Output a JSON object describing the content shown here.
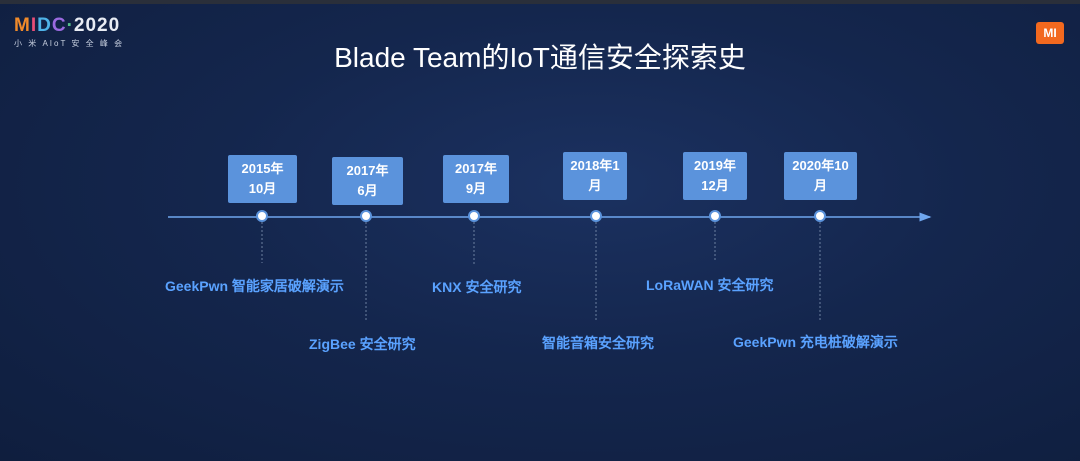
{
  "header": {
    "logo_text_parts": [
      "M",
      "I",
      "D",
      "C",
      "·"
    ],
    "logo_year": "2020",
    "logo_subtitle": "小 米 AIoT 安 全 峰 会",
    "brand_badge": "MI"
  },
  "slide": {
    "title": "Blade Team的IoT通信安全探索史"
  },
  "timeline": {
    "events": [
      {
        "date_line1": "2015年",
        "date_line2": "10月",
        "label": "GeekPwn 智能家居破解演示"
      },
      {
        "date_line1": "2017年",
        "date_line2": "6月",
        "label": "ZigBee 安全研究"
      },
      {
        "date_line1": "2017年",
        "date_line2": "9月",
        "label": "KNX 安全研究"
      },
      {
        "date_line1": "2018年1",
        "date_line2": "月",
        "label": "智能音箱安全研究"
      },
      {
        "date_line1": "2019年",
        "date_line2": "12月",
        "label": "LoRaWAN 安全研究"
      },
      {
        "date_line1": "2020年10",
        "date_line2": "月",
        "label": "GeekPwn 充电桩破解演示"
      }
    ]
  },
  "colors": {
    "accent": "#5b93dc",
    "label_text": "#5aa2ff",
    "brand_orange": "#f2691f"
  }
}
